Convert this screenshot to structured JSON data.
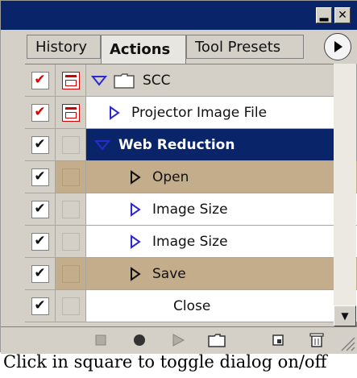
{
  "tabs": [
    {
      "label": "History"
    },
    {
      "label": "Actions"
    },
    {
      "label": "Tool Presets"
    }
  ],
  "actions": {
    "rows": [
      {
        "label": "SCC",
        "level": "set",
        "checked": true,
        "check_red": true,
        "dialog": "red",
        "expanded": true
      },
      {
        "label": "Projector Image File",
        "level": "action",
        "checked": true,
        "check_red": true,
        "dialog": "red",
        "expanded": false
      },
      {
        "label": "Web Reduction",
        "level": "action",
        "checked": true,
        "check_red": false,
        "dialog": "empty",
        "expanded": true,
        "selected": true
      },
      {
        "label": "Open",
        "level": "command",
        "checked": true,
        "dialog": "on",
        "expandable": true
      },
      {
        "label": "Image Size",
        "level": "command",
        "checked": true,
        "dialog": "empty",
        "expandable": true
      },
      {
        "label": "Image Size",
        "level": "command",
        "checked": true,
        "dialog": "empty",
        "expandable": true
      },
      {
        "label": "Save",
        "level": "command",
        "checked": true,
        "dialog": "on",
        "expandable": true
      },
      {
        "label": "Close",
        "level": "command",
        "checked": true,
        "dialog": "empty",
        "expandable": false
      }
    ]
  },
  "toolbar": {
    "buttons": [
      "stop-icon",
      "record-icon",
      "play-icon",
      "new-set-icon",
      "new-action-icon",
      "delete-icon"
    ]
  },
  "colors": {
    "titlebar": "#0a246a",
    "selected": "#0a246a",
    "dialog_on": "#c4ad8a",
    "check_red": "#e00000"
  },
  "caption": "Click in square to toggle dialog on/off"
}
